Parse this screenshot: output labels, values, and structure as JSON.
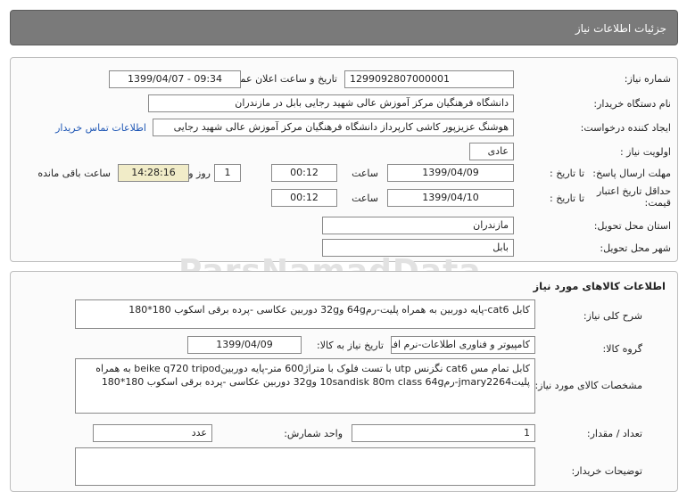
{
  "header": {
    "title": "جزئیات اطلاعات نیاز"
  },
  "details": {
    "need_number_label": "شماره نیاز:",
    "need_number": "1299092807000001",
    "announce_label": "تاریخ و ساعت اعلان عمومی:",
    "announce_value": "1399/04/07 - 09:34",
    "buyer_org_label": "نام دستگاه خریدار:",
    "buyer_org": "دانشگاه فرهنگیان مرکز آموزش عالی شهید رجایی بابل در مازندران",
    "requester_label": "ایجاد کننده درخواست:",
    "requester": "هوشنگ عزیزپور کاشی کارپرداز دانشگاه فرهنگیان مرکز آموزش عالی شهید رجایی",
    "contact_link": "اطلاعات تماس خریدار",
    "priority_label": "اولویت نیاز :",
    "priority": "عادی",
    "deadline_label": "مهلت ارسال پاسخ:",
    "to_date_label": "تا تاریخ :",
    "deadline_date": "1399/04/09",
    "time_label": "ساعت",
    "deadline_time": "00:12",
    "days_value": "1",
    "days_label": "روز و",
    "remaining_time": "14:28:16",
    "remaining_label": "ساعت باقی مانده",
    "validity_label": "حداقل تاریخ اعتبار قیمت:",
    "validity_to_label": "تا تاریخ :",
    "validity_date": "1399/04/10",
    "validity_time_label": "ساعت",
    "validity_time": "00:12",
    "province_label": "استان محل تحویل:",
    "province": "مازندران",
    "city_label": "شهر محل تحویل:",
    "city": "بابل"
  },
  "goods": {
    "title": "اطلاعات کالاهای مورد نیاز",
    "summary_label": "شرح کلی نیاز:",
    "summary": "کابل cat6-پایه دوربین به همراه پلیت-رم64g و32g دوربین عکاسی -پرده برقی اسکوب 180*180",
    "group_label": "گروه کالا:",
    "group": "کامپیوتر و فناوری اطلاعات-نرم افزار",
    "need_date_label": "تاریخ نیاز به کالا:",
    "need_date": "1399/04/09",
    "spec_label": "مشخصات کالای مورد نیاز:",
    "spec": "کابل تمام مس cat6 نگزنس utp با تست فلوک با متراژ600 متر-پایه دوربینbeike q720 tripod به همراه پلیتjmary2264-رم10sandisk 80m class 64g و32g دوربین عکاسی -پرده برقی اسکوب 180*180",
    "unit_label": "واحد شمارش:",
    "unit": "عدد",
    "quantity_label": "تعداد / مقدار:",
    "quantity": "1",
    "buyer_notes_label": "توضیحات خریدار:",
    "buyer_notes": ""
  },
  "watermark": "ParsNamadData"
}
